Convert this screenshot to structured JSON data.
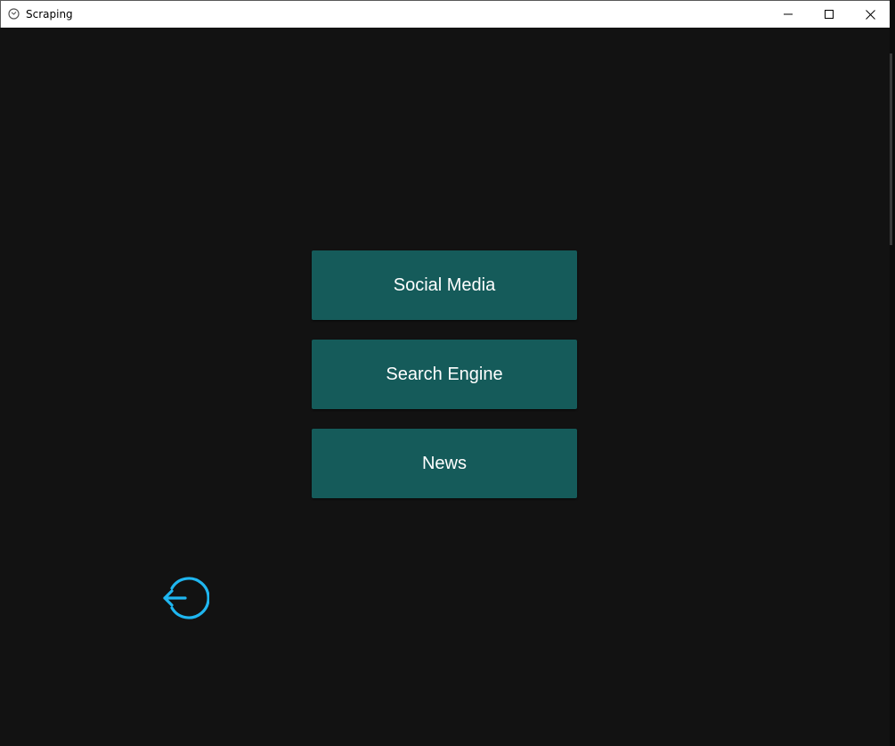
{
  "window": {
    "title": "Scraping",
    "icons": {
      "app": "app-logo-icon",
      "minimize": "minimize-icon",
      "maximize": "maximize-icon",
      "close": "close-icon"
    }
  },
  "menu": {
    "buttons": [
      {
        "label": "Social Media"
      },
      {
        "label": "Search Engine"
      },
      {
        "label": "News"
      }
    ]
  },
  "back": {
    "icon": "logout-arrow-icon"
  },
  "colors": {
    "background": "#121212",
    "button": "#155b5a",
    "button_text": "#ffffff",
    "accent": "#1fb6f0",
    "titlebar": "#ffffff"
  }
}
